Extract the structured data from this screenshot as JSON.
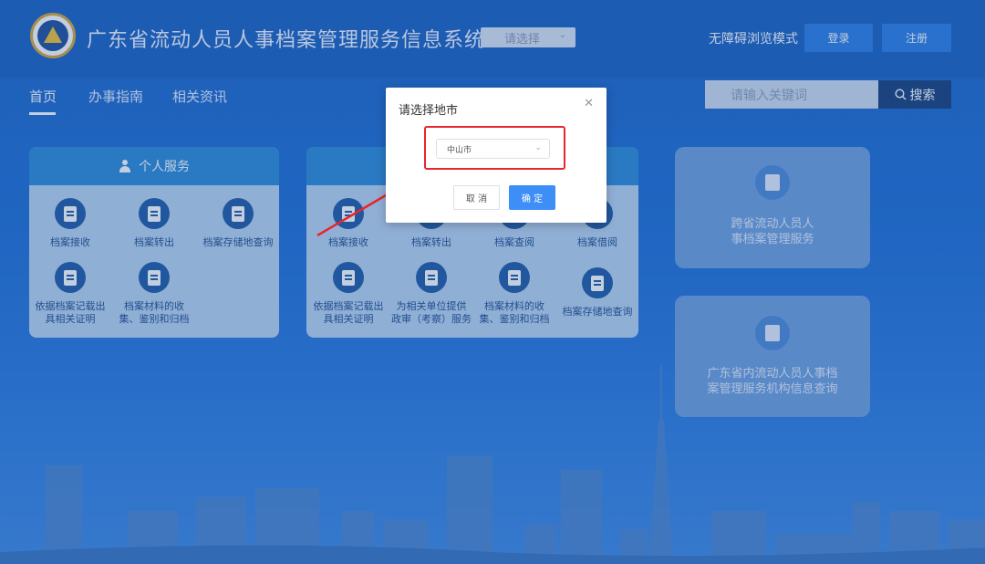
{
  "header": {
    "title": "广东省流动人员人事档案管理服务信息系统",
    "region_select": "请选择",
    "accessibility_label": "无障碍浏览模式",
    "login_label": "登录",
    "register_label": "注册"
  },
  "nav": {
    "items": [
      "首页",
      "办事指南",
      "相关资讯"
    ],
    "search_placeholder": "请输入关键词",
    "search_button": "搜索"
  },
  "personal_service": {
    "title": "个人服务",
    "items": [
      "档案接收",
      "档案转出",
      "档案存储地查询",
      "依据档案记载出\n具相关证明",
      "档案材料的收\n集、鉴别和归档"
    ]
  },
  "unit_service": {
    "items": [
      "档案接收",
      "档案转出",
      "档案查阅",
      "档案借阅",
      "依据档案记载出\n具相关证明",
      "为相关单位提供\n政审（考察）服务",
      "档案材料的收\n集、鉴别和归档",
      "档案存储地查询"
    ]
  },
  "side_cards": {
    "card1": "跨省流动人员人\n事档案管理服务",
    "card2": "广东省内流动人员人事档\n案管理服务机构信息查询"
  },
  "dialog": {
    "title": "请选择地市",
    "selected_city": "中山市",
    "cancel_label": "取 消",
    "ok_label": "确 定"
  },
  "colors": {
    "header_bg": "#1a62c2",
    "primary_button": "#3d8ef7",
    "highlight": "#e8262b",
    "card_header": "#2a8ad8"
  }
}
